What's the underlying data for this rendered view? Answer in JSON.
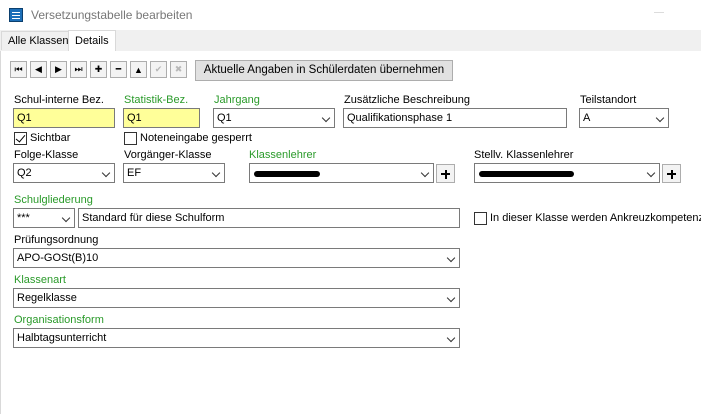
{
  "window": {
    "title": "Versetzungstabelle bearbeiten"
  },
  "tabs": [
    {
      "label": "Alle Klassen",
      "active": false
    },
    {
      "label": "Details",
      "active": true
    }
  ],
  "toolbar": {
    "buttons": [
      {
        "name": "first-record-button",
        "glyph": "⏮",
        "enabled": true
      },
      {
        "name": "prev-record-button",
        "glyph": "◀",
        "enabled": true
      },
      {
        "name": "next-record-button",
        "glyph": "▶",
        "enabled": true
      },
      {
        "name": "last-record-button",
        "glyph": "⏭",
        "enabled": true
      },
      {
        "name": "add-record-button",
        "glyph": "✚",
        "enabled": true
      },
      {
        "name": "delete-record-button",
        "glyph": "━",
        "enabled": true
      },
      {
        "name": "edit-record-button",
        "glyph": "▲",
        "enabled": true
      },
      {
        "name": "confirm-button",
        "glyph": "✔",
        "enabled": false
      },
      {
        "name": "cancel-button",
        "glyph": "✖",
        "enabled": false
      }
    ],
    "apply_label": "Aktuelle Angaben in Schülerdaten übernehmen"
  },
  "form": {
    "schul_interne_bez": {
      "label": "Schul-interne Bez.",
      "value": "Q1"
    },
    "statistik_bez": {
      "label": "Statistik-Bez.",
      "value": "Q1"
    },
    "jahrgang": {
      "label": "Jahrgang",
      "value": "Q1"
    },
    "zusaetzliche_beschreibung": {
      "label": "Zusätzliche Beschreibung",
      "value": "Qualifikationsphase 1"
    },
    "teilstandort": {
      "label": "Teilstandort",
      "value": "A"
    },
    "sichtbar": {
      "label": "Sichtbar",
      "checked": true
    },
    "noteneingabe_gesperrt": {
      "label": "Noteneingabe gesperrt",
      "checked": false
    },
    "folge_klasse": {
      "label": "Folge-Klasse",
      "value": "Q2"
    },
    "vorgaenger_klasse": {
      "label": "Vorgänger-Klasse",
      "value": "EF"
    },
    "klassenlehrer": {
      "label": "Klassenlehrer",
      "value": ""
    },
    "stellv_klassenlehrer": {
      "label": "Stellv. Klassenlehrer",
      "value": ""
    },
    "schulgliederung": {
      "label": "Schulgliederung",
      "code": "***",
      "description": "Standard für diese Schulform"
    },
    "ankreuzkompetenzen": {
      "label": "In dieser Klasse werden Ankreuzkompetenze",
      "checked": false
    },
    "pruefungsordnung": {
      "label": "Prüfungsordnung",
      "value": "APO-GOSt(B)10"
    },
    "klassenart": {
      "label": "Klassenart",
      "value": "Regelklasse"
    },
    "organisationsform": {
      "label": "Organisationsform",
      "value": "Halbtagsunterricht"
    }
  },
  "colors": {
    "required_label": "#2a9a2a",
    "highlight_field": "#ffff99"
  }
}
